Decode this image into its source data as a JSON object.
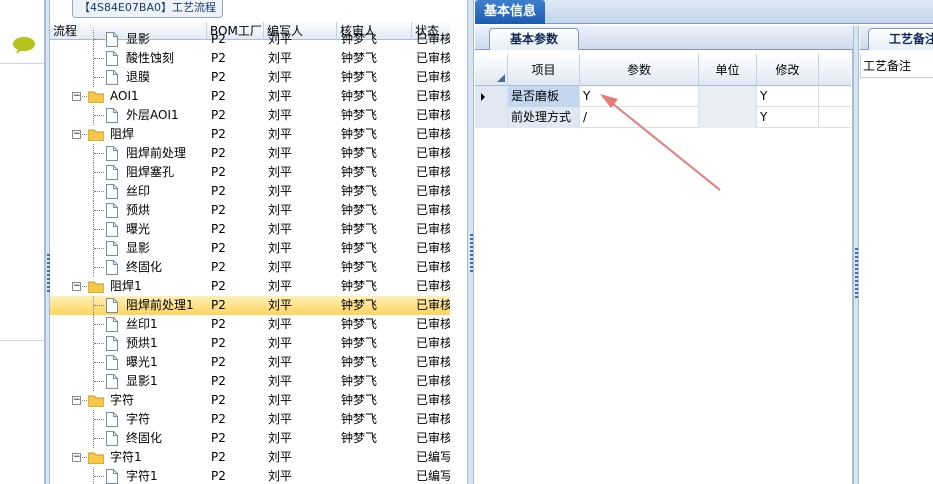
{
  "left_panel": {
    "icon": "speech-bubble-icon"
  },
  "tree": {
    "title": "【4S84E07BA0】工艺流程",
    "columns": {
      "flow": "流程",
      "bom": "BOM工厂",
      "writer": "编写人",
      "reviewer": "核审人",
      "status": "状态"
    },
    "rows": [
      {
        "name": "显影",
        "type": "file",
        "level": 1,
        "bom": "P2",
        "writer": "刘平",
        "reviewer": "钟梦飞",
        "status": "已审核"
      },
      {
        "name": "酸性蚀刻",
        "type": "file",
        "level": 1,
        "bom": "P2",
        "writer": "刘平",
        "reviewer": "钟梦飞",
        "status": "已审核"
      },
      {
        "name": "退膜",
        "type": "file",
        "level": 1,
        "bom": "P2",
        "writer": "刘平",
        "reviewer": "钟梦飞",
        "status": "已审核"
      },
      {
        "name": "AOI1",
        "type": "folder",
        "level": 0,
        "bom": "P2",
        "writer": "刘平",
        "reviewer": "钟梦飞",
        "status": "已审核"
      },
      {
        "name": "外层AOI1",
        "type": "file",
        "level": 1,
        "bom": "P2",
        "writer": "刘平",
        "reviewer": "钟梦飞",
        "status": "已审核"
      },
      {
        "name": "阻焊",
        "type": "folder",
        "level": 0,
        "bom": "P2",
        "writer": "刘平",
        "reviewer": "钟梦飞",
        "status": "已审核"
      },
      {
        "name": "阻焊前处理",
        "type": "file",
        "level": 1,
        "bom": "P2",
        "writer": "刘平",
        "reviewer": "钟梦飞",
        "status": "已审核"
      },
      {
        "name": "阻焊塞孔",
        "type": "file",
        "level": 1,
        "bom": "P2",
        "writer": "刘平",
        "reviewer": "钟梦飞",
        "status": "已审核"
      },
      {
        "name": "丝印",
        "type": "file",
        "level": 1,
        "bom": "P2",
        "writer": "刘平",
        "reviewer": "钟梦飞",
        "status": "已审核"
      },
      {
        "name": "预烘",
        "type": "file",
        "level": 1,
        "bom": "P2",
        "writer": "刘平",
        "reviewer": "钟梦飞",
        "status": "已审核"
      },
      {
        "name": "曝光",
        "type": "file",
        "level": 1,
        "bom": "P2",
        "writer": "刘平",
        "reviewer": "钟梦飞",
        "status": "已审核"
      },
      {
        "name": "显影",
        "type": "file",
        "level": 1,
        "bom": "P2",
        "writer": "刘平",
        "reviewer": "钟梦飞",
        "status": "已审核"
      },
      {
        "name": "终固化",
        "type": "file",
        "level": 1,
        "bom": "P2",
        "writer": "刘平",
        "reviewer": "钟梦飞",
        "status": "已审核"
      },
      {
        "name": "阻焊1",
        "type": "folder",
        "level": 0,
        "bom": "P2",
        "writer": "刘平",
        "reviewer": "钟梦飞",
        "status": "已审核"
      },
      {
        "name": "阻焊前处理1",
        "type": "file",
        "level": 1,
        "bom": "P2",
        "writer": "刘平",
        "reviewer": "钟梦飞",
        "status": "已审核",
        "selected": true
      },
      {
        "name": "丝印1",
        "type": "file",
        "level": 1,
        "bom": "P2",
        "writer": "刘平",
        "reviewer": "钟梦飞",
        "status": "已审核"
      },
      {
        "name": "预烘1",
        "type": "file",
        "level": 1,
        "bom": "P2",
        "writer": "刘平",
        "reviewer": "钟梦飞",
        "status": "已审核"
      },
      {
        "name": "曝光1",
        "type": "file",
        "level": 1,
        "bom": "P2",
        "writer": "刘平",
        "reviewer": "钟梦飞",
        "status": "已审核"
      },
      {
        "name": "显影1",
        "type": "file",
        "level": 1,
        "bom": "P2",
        "writer": "刘平",
        "reviewer": "钟梦飞",
        "status": "已审核"
      },
      {
        "name": "字符",
        "type": "folder",
        "level": 0,
        "bom": "P2",
        "writer": "刘平",
        "reviewer": "钟梦飞",
        "status": "已审核"
      },
      {
        "name": "字符",
        "type": "file",
        "level": 1,
        "bom": "P2",
        "writer": "刘平",
        "reviewer": "钟梦飞",
        "status": "已审核"
      },
      {
        "name": "终固化",
        "type": "file",
        "level": 1,
        "bom": "P2",
        "writer": "刘平",
        "reviewer": "钟梦飞",
        "status": "已审核"
      },
      {
        "name": "字符1",
        "type": "folder",
        "level": 0,
        "bom": "P2",
        "writer": "刘平",
        "reviewer": "",
        "status": "已编写"
      },
      {
        "name": "字符1",
        "type": "file",
        "level": 1,
        "bom": "P2",
        "writer": "刘平",
        "reviewer": "",
        "status": "已编写"
      }
    ]
  },
  "right": {
    "top_tab": "基本信息",
    "params_tab": "基本参数",
    "params_columns": {
      "item": "项目",
      "param": "参数",
      "unit": "单位",
      "modify": "修改"
    },
    "params_rows": [
      {
        "item": "是否磨板",
        "param": "Y",
        "unit": "",
        "modify": "Y",
        "current": true
      },
      {
        "item": "前处理方式",
        "param": "/",
        "unit": "",
        "modify": "Y",
        "current": false
      }
    ],
    "remarks_tab": "工艺备注",
    "remarks_label": "工艺备注"
  },
  "colors": {
    "selected_row": "#ffd35f",
    "tab_active": "#1c5bb0",
    "annotation_arrow": "#e87a7a"
  }
}
